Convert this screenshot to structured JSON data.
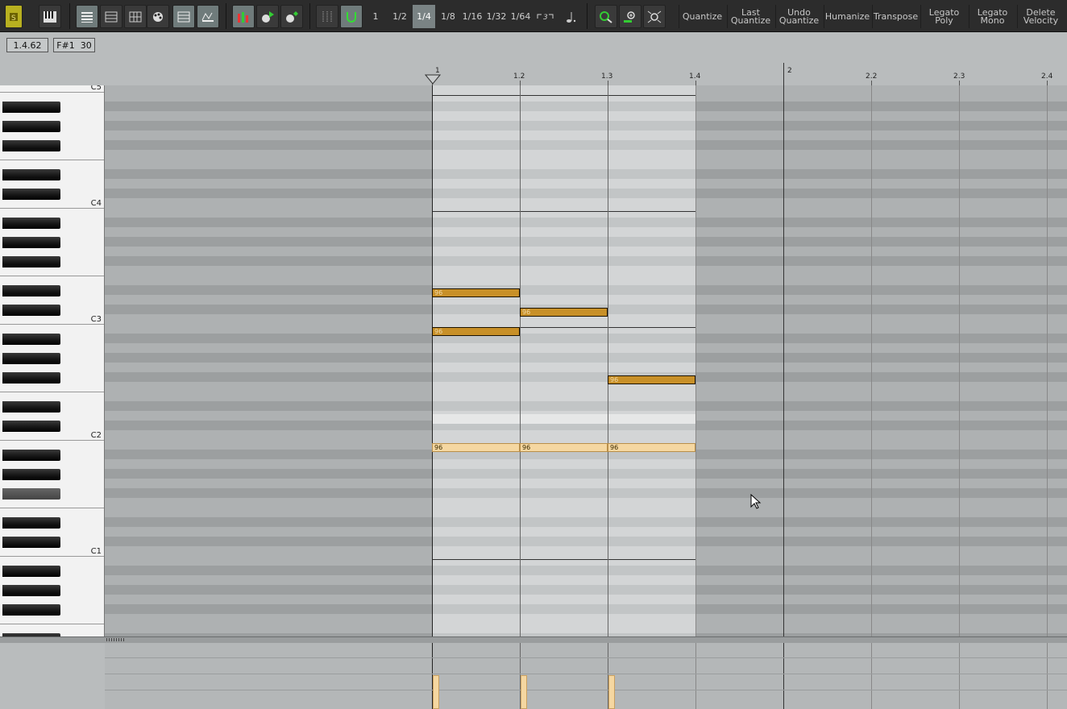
{
  "toolbar": {
    "grid_options": [
      "1",
      "1/2",
      "1/4",
      "1/8",
      "1/16",
      "1/32",
      "1/64"
    ],
    "active_grid": "1/4",
    "actions": [
      {
        "label": "Quantize"
      },
      {
        "label": "Last Quantize"
      },
      {
        "label": "Undo Quantize"
      },
      {
        "label": "Humanize"
      },
      {
        "label": "Transpose"
      },
      {
        "label": "Legato Poly"
      },
      {
        "label": "Legato Mono"
      },
      {
        "label": "Delete Velocity"
      }
    ]
  },
  "status": {
    "position": "1.4.62",
    "note_info": "F#1  30"
  },
  "ruler": {
    "labels": [
      "1",
      "1.2",
      "1.3",
      "1.4",
      "2",
      "2.2",
      "2.3",
      "2.4"
    ]
  },
  "keyboard": {
    "octave_labels": [
      "C5",
      "C4",
      "C3",
      "C2",
      "C1"
    ]
  },
  "notes": [
    {
      "velocity": "96",
      "selected": false
    },
    {
      "velocity": "96",
      "selected": false
    },
    {
      "velocity": "96",
      "selected": false
    },
    {
      "velocity": "96",
      "selected": false
    },
    {
      "velocity": "96",
      "selected": true
    },
    {
      "velocity": "96",
      "selected": true
    },
    {
      "velocity": "96",
      "selected": true
    }
  ],
  "colors": {
    "note": "#c89028",
    "note_selected": "#f5d7a1",
    "toolbar_bg": "#2c2c2c"
  }
}
